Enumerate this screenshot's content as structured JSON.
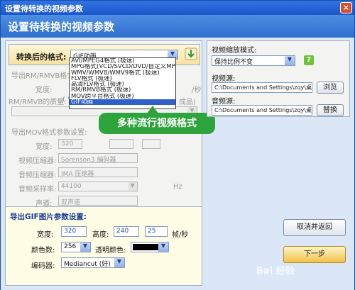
{
  "window": {
    "title": "设置待转换的视频参数",
    "close": "×"
  },
  "header": {
    "title": "设置待转换的视频参数"
  },
  "format": {
    "label": "转换后的格式:",
    "selected": "GIF动画",
    "options": [
      "AVI/MPEG4格式      (极速)",
      "MPG格式(VCD/SVCD/DVD/自定义MPEG)",
      "WMV/WMV8/WMV9格式    (极速)",
      "FLV格式            (极速)",
      "高清FLV格式        (极速)",
      "RM/RMVB格式        (极速)",
      "MOV跨平台格式      (极速)",
      "GIF动画"
    ]
  },
  "callout": {
    "text": "多种流行视频格式"
  },
  "rm_section": {
    "title": "导出RM/RMVB格式",
    "width_label": "宽度:",
    "fps_suffix": "/秒",
    "quality_label": "RM/RMVB的质量:",
    "quality_hint": "( V",
    "quality_tail": "成品)"
  },
  "mov_section": {
    "title": "导出MOV格式参数设置:",
    "width_label": "宽度:",
    "width_value": "320",
    "video_codec_label": "视频压缩器:",
    "video_codec_value": "Sorenson3 编码器",
    "audio_codec_label": "音频压缩器:",
    "audio_codec_value": "IMA 压缩器",
    "sample_rate_label": "音频采样率:",
    "sample_rate_value": "44100",
    "hz": "Hz",
    "channel_label": "声道:",
    "channel_value": "双声道"
  },
  "gif_section": {
    "title": "导出GIF图片参数设置:",
    "width_label": "宽度:",
    "width_value": "320",
    "height_label": "高度:",
    "height_value": "240",
    "fps_value": "25",
    "fps_unit": "帧/秒",
    "colors_label": "颜色数:",
    "colors_value": "256",
    "transparent_label": "透明颜色:",
    "encoder_label": "编码器:",
    "encoder_value": "Mediancut (好)"
  },
  "right": {
    "scale_label": "视频缩放模式:",
    "scale_value": "保持比例不变",
    "help": "?",
    "video_source_label": "视频源:",
    "video_source_value": "C:\\Documents and Settings\\zqy\\桌",
    "browse": "浏览",
    "audio_source_label": "音频源:",
    "audio_source_value": "C:\\Documents and Settings\\zqy\\桌",
    "replace": "替换",
    "cancel": "取消并返回",
    "next": "下一步"
  },
  "watermark": {
    "text": "Bai 经验"
  },
  "colors": {
    "titlebar": "#1c56c9",
    "callout": "#2fa43d",
    "selected": "#2f5fcb"
  }
}
